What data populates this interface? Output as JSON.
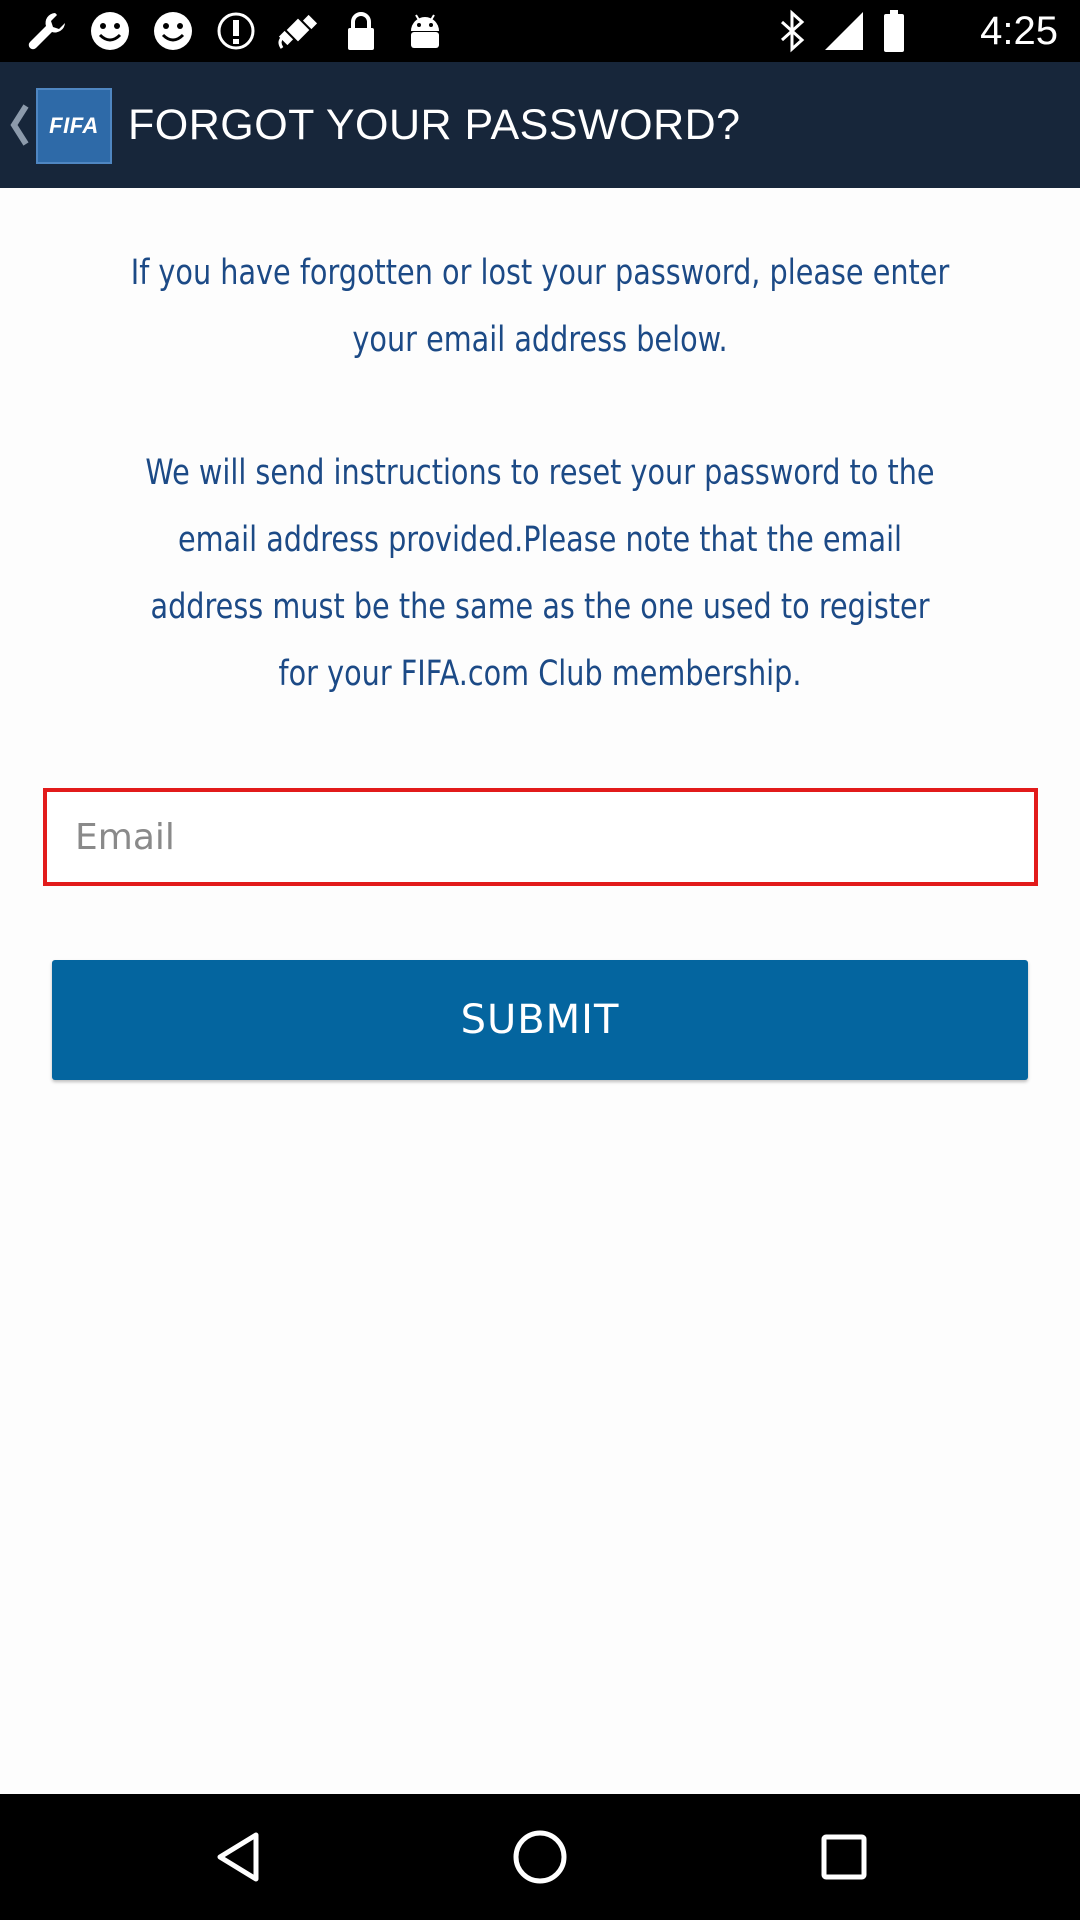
{
  "status_bar": {
    "icons": [
      "wrench-icon",
      "smiley-icon",
      "smiley-icon",
      "info-icon",
      "fake-gps-icon",
      "lock-icon",
      "android-icon",
      "bluetooth-icon",
      "signal-icon",
      "battery-icon"
    ],
    "time": "4:25"
  },
  "app_bar": {
    "back_icon": "chevron-left-icon",
    "logo_text": "FIFA",
    "title": "FORGOT YOUR PASSWORD?"
  },
  "instructions": {
    "paragraph_1": "If you have forgotten or lost your password, please enter your email address below.",
    "paragraph_2": "We will send instructions to reset your password to the email address provided.Please note that the email address must be the same as the one used to register for your FIFA.com Club membership."
  },
  "form": {
    "email_placeholder": "Email",
    "email_value": "",
    "submit_label": "SUBMIT"
  },
  "colors": {
    "app_bar": "#17263a",
    "text": "#1c4a86",
    "field_border": "#e21b1b",
    "button": "#04659f"
  },
  "nav_bar": {
    "buttons": [
      "back-triangle-icon",
      "home-circle-icon",
      "recents-square-icon"
    ]
  }
}
